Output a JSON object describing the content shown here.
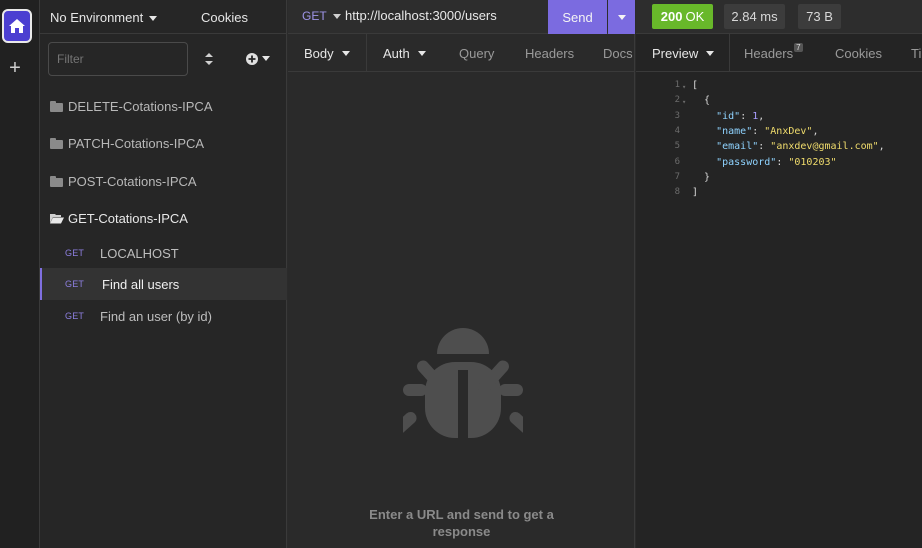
{
  "colors": {
    "accent": "#7b6be0",
    "success": "#68b82a",
    "method": "#8d7fe0"
  },
  "sidebar": {
    "environment": "No Environment",
    "cookies": "Cookies",
    "filter_placeholder": "Filter",
    "folders": [
      {
        "label": "DELETE-Cotations-IPCA",
        "open": false
      },
      {
        "label": "PATCH-Cotations-IPCA",
        "open": false
      },
      {
        "label": "POST-Cotations-IPCA",
        "open": false
      },
      {
        "label": "GET-Cotations-IPCA",
        "open": true
      }
    ],
    "requests": [
      {
        "method": "GET",
        "name": "LOCALHOST",
        "selected": false
      },
      {
        "method": "GET",
        "name": "Find all users",
        "selected": true
      },
      {
        "method": "GET",
        "name": "Find an user (by id)",
        "selected": false
      }
    ]
  },
  "request": {
    "method": "GET",
    "url": "http://localhost:3000/users",
    "send_label": "Send",
    "tabs": [
      "Body",
      "Auth",
      "Query",
      "Headers",
      "Docs"
    ],
    "empty_hint": "Enter a URL and send to get a response"
  },
  "response": {
    "status": "200",
    "status_text": "OK",
    "time": "2.84 ms",
    "size": "73 B",
    "tabs": [
      "Preview",
      "Headers",
      "Cookies",
      "Ti"
    ],
    "headers_count": "7",
    "lines": [
      {
        "n": "1",
        "fold": "▾",
        "parts": [
          {
            "t": "[",
            "c": ""
          }
        ]
      },
      {
        "n": "2",
        "fold": "▾",
        "parts": [
          {
            "t": "  {",
            "c": ""
          }
        ]
      },
      {
        "n": "3",
        "fold": "",
        "parts": [
          {
            "t": "    ",
            "c": ""
          },
          {
            "t": "\"id\"",
            "c": "k"
          },
          {
            "t": ": ",
            "c": ""
          },
          {
            "t": "1",
            "c": "num"
          },
          {
            "t": ",",
            "c": ""
          }
        ]
      },
      {
        "n": "4",
        "fold": "",
        "parts": [
          {
            "t": "    ",
            "c": ""
          },
          {
            "t": "\"name\"",
            "c": "k"
          },
          {
            "t": ": ",
            "c": ""
          },
          {
            "t": "\"AnxDev\"",
            "c": "s"
          },
          {
            "t": ",",
            "c": ""
          }
        ]
      },
      {
        "n": "5",
        "fold": "",
        "parts": [
          {
            "t": "    ",
            "c": ""
          },
          {
            "t": "\"email\"",
            "c": "k"
          },
          {
            "t": ": ",
            "c": ""
          },
          {
            "t": "\"anxdev@gmail.com\"",
            "c": "s"
          },
          {
            "t": ",",
            "c": ""
          }
        ]
      },
      {
        "n": "6",
        "fold": "",
        "parts": [
          {
            "t": "    ",
            "c": ""
          },
          {
            "t": "\"password\"",
            "c": "k"
          },
          {
            "t": ": ",
            "c": ""
          },
          {
            "t": "\"010203\"",
            "c": "s"
          }
        ]
      },
      {
        "n": "7",
        "fold": "",
        "parts": [
          {
            "t": "  }",
            "c": ""
          }
        ]
      },
      {
        "n": "8",
        "fold": "",
        "parts": [
          {
            "t": "]",
            "c": ""
          }
        ]
      }
    ]
  }
}
